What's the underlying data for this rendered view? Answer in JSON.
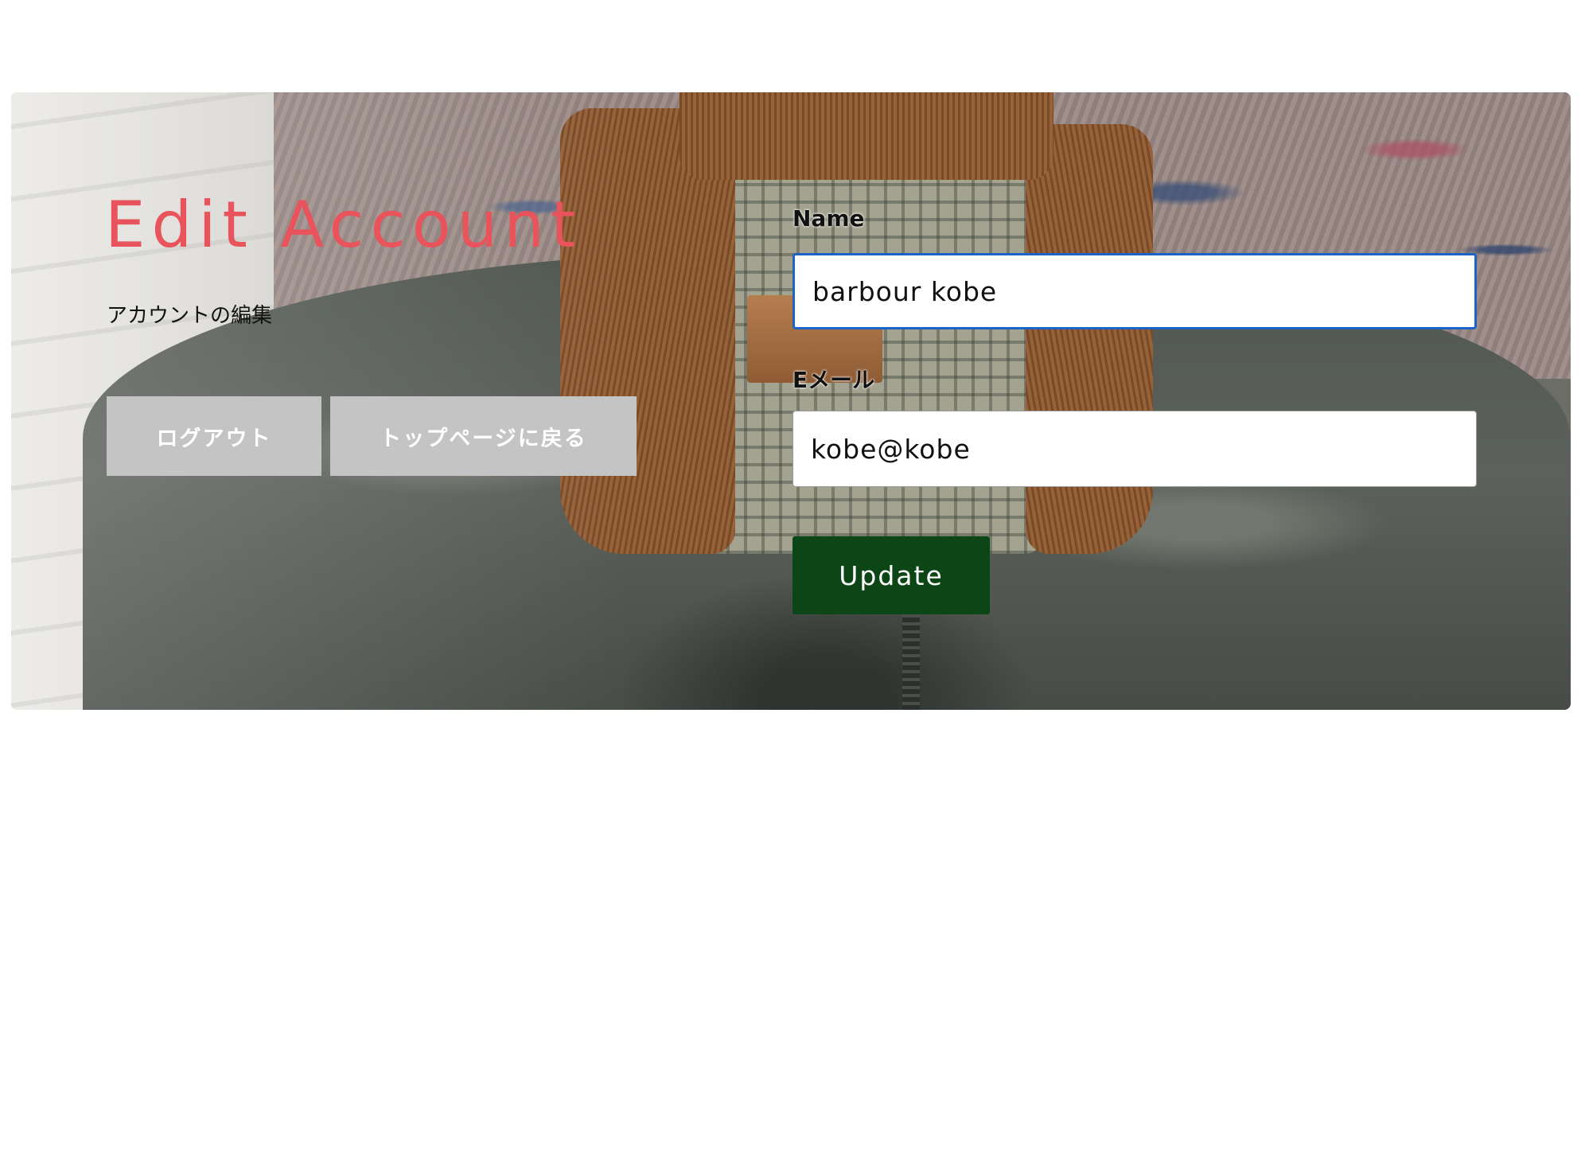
{
  "page": {
    "title": "Edit Account",
    "subtitle": "アカウントの編集"
  },
  "actions": {
    "logout_label": "ログアウト",
    "back_to_top_label": "トップページに戻る"
  },
  "form": {
    "name_label": "Name",
    "name_value": "barbour kobe",
    "email_label": "Eメール",
    "email_value": "kobe@kobe",
    "submit_label": "Update"
  },
  "colors": {
    "title_accent": "#e8535c",
    "update_button": "#0c4616",
    "secondary_button": "#c4c4c4",
    "focus_border": "#1b63c7"
  },
  "background_image": "barbour-jacket-photo"
}
